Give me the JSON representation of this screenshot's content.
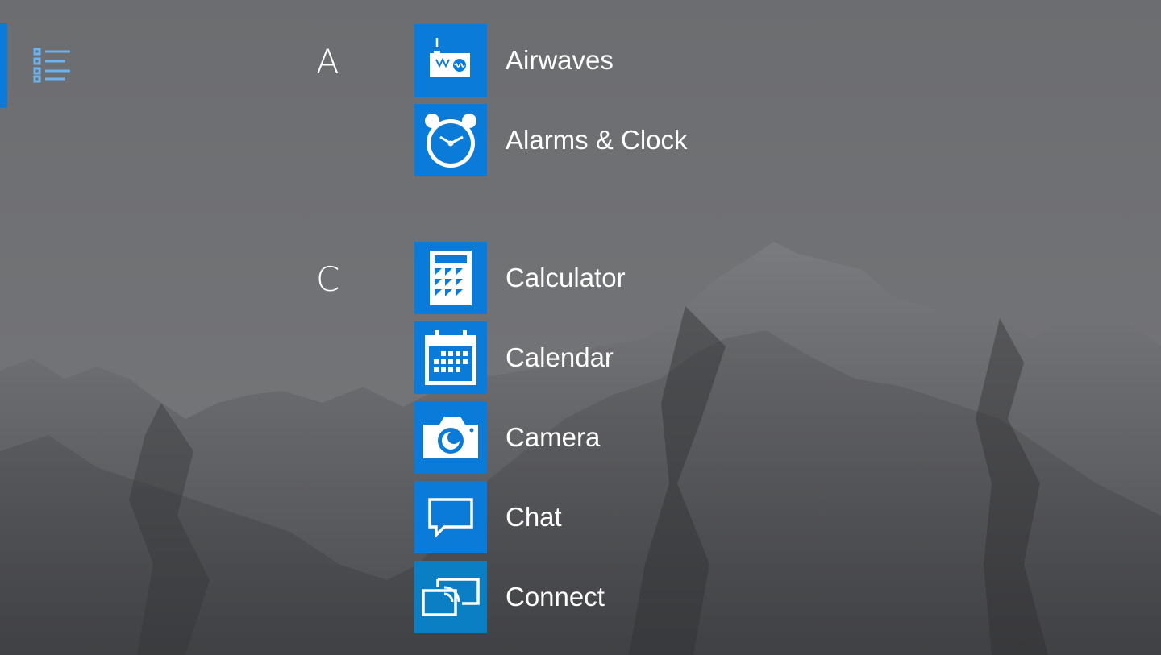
{
  "start_menu": {
    "accent_color": "#0a7bd8",
    "tile_color": "#0a7bd8",
    "connect_tile_color": "#0b7fc4",
    "all_apps_icon": "all-apps-list-icon",
    "groups": [
      {
        "letter": "A",
        "apps": [
          {
            "label": "Airwaves",
            "icon": "radio-icon"
          },
          {
            "label": "Alarms & Clock",
            "icon": "alarm-clock-icon"
          }
        ]
      },
      {
        "letter": "C",
        "apps": [
          {
            "label": "Calculator",
            "icon": "calculator-icon"
          },
          {
            "label": "Calendar",
            "icon": "calendar-icon"
          },
          {
            "label": "Camera",
            "icon": "camera-icon"
          },
          {
            "label": "Chat",
            "icon": "chat-icon"
          },
          {
            "label": "Connect",
            "icon": "connect-icon"
          }
        ]
      }
    ]
  }
}
